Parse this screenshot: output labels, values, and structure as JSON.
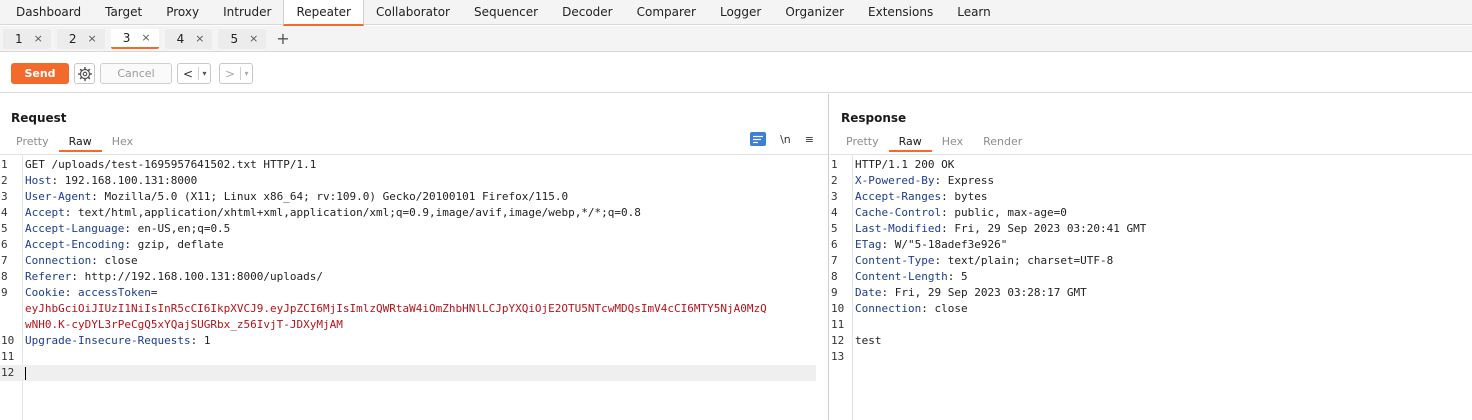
{
  "topnav": {
    "tabs": [
      "Dashboard",
      "Target",
      "Proxy",
      "Intruder",
      "Repeater",
      "Collaborator",
      "Sequencer",
      "Decoder",
      "Comparer",
      "Logger",
      "Organizer",
      "Extensions",
      "Learn"
    ],
    "active": "Repeater"
  },
  "repeater_tabs": {
    "tabs": [
      "1",
      "2",
      "3",
      "4",
      "5"
    ],
    "active": "3",
    "close_glyph": "×",
    "add_glyph": "+"
  },
  "toolbar": {
    "send_label": "Send",
    "cancel_label": "Cancel",
    "back_glyph": "<",
    "forward_glyph": ">",
    "dropdown_glyph": "▾",
    "gear_icon": "gear-icon"
  },
  "request": {
    "title": "Request",
    "view_tabs": [
      "Pretty",
      "Raw",
      "Hex"
    ],
    "active_view": "Raw",
    "tools": {
      "newline_label": "\\n",
      "menu_glyph": "≡"
    },
    "lines": [
      {
        "n": "1",
        "name": "",
        "value": "GET /uploads/test-1695957641502.txt HTTP/1.1"
      },
      {
        "n": "2",
        "name": "Host",
        "value": " 192.168.100.131:8000"
      },
      {
        "n": "3",
        "name": "User-Agent",
        "value": " Mozilla/5.0 (X11; Linux x86_64; rv:109.0) Gecko/20100101 Firefox/115.0"
      },
      {
        "n": "4",
        "name": "Accept",
        "value": " text/html,application/xhtml+xml,application/xml;q=0.9,image/avif,image/webp,*/*;q=0.8"
      },
      {
        "n": "5",
        "name": "Accept-Language",
        "value": " en-US,en;q=0.5"
      },
      {
        "n": "6",
        "name": "Accept-Encoding",
        "value": " gzip, deflate"
      },
      {
        "n": "7",
        "name": "Connection",
        "value": " close"
      },
      {
        "n": "8",
        "name": "Referer",
        "value": " http://192.168.100.131:8000/uploads/"
      },
      {
        "n": "9",
        "name": "Cookie",
        "value": " ",
        "cookie_name": "accessToken",
        "cookie_eq": "="
      },
      {
        "n": "",
        "name": "",
        "value": "",
        "red": "eyJhbGciOiJIUzI1NiIsInR5cCI6IkpXVCJ9.eyJpZCI6MjIsImlzQWRtaW4iOmZhbHNlLCJpYXQiOjE2OTU5NTcwMDQsImV4cCI6MTY5NjA0MzQ"
      },
      {
        "n": "",
        "name": "",
        "value": "",
        "red": "wNH0.K-cyDYL3rPeCgQ5xYQajSUGRbx_z56IvjT-JDXyMjAM"
      },
      {
        "n": "10",
        "name": "Upgrade-Insecure-Requests",
        "value": " 1"
      },
      {
        "n": "11",
        "name": "",
        "value": ""
      },
      {
        "n": "12",
        "name": "",
        "value": "",
        "current": true
      }
    ]
  },
  "response": {
    "title": "Response",
    "view_tabs": [
      "Pretty",
      "Raw",
      "Hex",
      "Render"
    ],
    "active_view": "Raw",
    "lines": [
      {
        "n": "1",
        "name": "",
        "value": "HTTP/1.1 200 OK"
      },
      {
        "n": "2",
        "name": "X-Powered-By",
        "value": " Express"
      },
      {
        "n": "3",
        "name": "Accept-Ranges",
        "value": " bytes"
      },
      {
        "n": "4",
        "name": "Cache-Control",
        "value": " public, max-age=0"
      },
      {
        "n": "5",
        "name": "Last-Modified",
        "value": " Fri, 29 Sep 2023 03:20:41 GMT"
      },
      {
        "n": "6",
        "name": "ETag",
        "value": " W/\"5-18adef3e926\""
      },
      {
        "n": "7",
        "name": "Content-Type",
        "value": " text/plain; charset=UTF-8"
      },
      {
        "n": "8",
        "name": "Content-Length",
        "value": " 5"
      },
      {
        "n": "9",
        "name": "Date",
        "value": " Fri, 29 Sep 2023 03:28:17 GMT"
      },
      {
        "n": "10",
        "name": "Connection",
        "value": " close"
      },
      {
        "n": "11",
        "name": "",
        "value": ""
      },
      {
        "n": "12",
        "name": "",
        "value": "test"
      },
      {
        "n": "13",
        "name": "",
        "value": ""
      }
    ]
  }
}
